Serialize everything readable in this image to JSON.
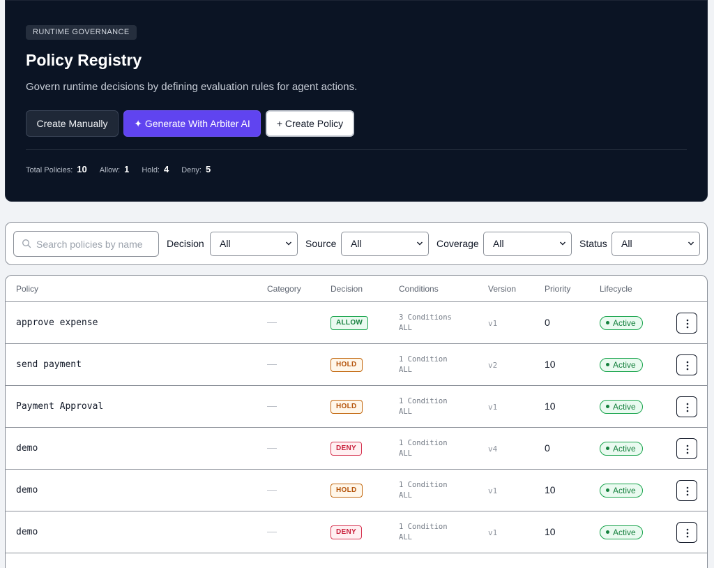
{
  "header": {
    "eyebrow": "RUNTIME GOVERNANCE",
    "title": "Policy Registry",
    "subtitle": "Govern runtime decisions by defining evaluation rules for agent actions.",
    "buttons": {
      "create_manually": "Create Manually",
      "generate_ai": "✦ Generate With Arbiter AI",
      "create_policy": "+ Create Policy"
    },
    "stats": [
      {
        "label": "Total Policies:",
        "value": "10"
      },
      {
        "label": "Allow:",
        "value": "1"
      },
      {
        "label": "Hold:",
        "value": "4"
      },
      {
        "label": "Deny:",
        "value": "5"
      }
    ]
  },
  "filters": {
    "search_placeholder": "Search policies by name",
    "decision": {
      "label": "Decision",
      "value": "All"
    },
    "source": {
      "label": "Source",
      "value": "All"
    },
    "coverage": {
      "label": "Coverage",
      "value": "All"
    },
    "status": {
      "label": "Status",
      "value": "All"
    }
  },
  "table": {
    "columns": [
      "Policy",
      "Category",
      "Decision",
      "Conditions",
      "Version",
      "Priority",
      "Lifecycle"
    ],
    "rows": [
      {
        "policy": "approve expense",
        "category": "—",
        "decision": "ALLOW",
        "conditions": "3 Conditions",
        "match": "ALL",
        "version": "v1",
        "priority": "0",
        "lifecycle": "Active"
      },
      {
        "policy": "send payment",
        "category": "—",
        "decision": "HOLD",
        "conditions": "1 Condition",
        "match": "ALL",
        "version": "v2",
        "priority": "10",
        "lifecycle": "Active"
      },
      {
        "policy": "Payment Approval",
        "category": "—",
        "decision": "HOLD",
        "conditions": "1 Condition",
        "match": "ALL",
        "version": "v1",
        "priority": "10",
        "lifecycle": "Active"
      },
      {
        "policy": "demo",
        "category": "—",
        "decision": "DENY",
        "conditions": "1 Condition",
        "match": "ALL",
        "version": "v4",
        "priority": "0",
        "lifecycle": "Active"
      },
      {
        "policy": "demo",
        "category": "—",
        "decision": "HOLD",
        "conditions": "1 Condition",
        "match": "ALL",
        "version": "v1",
        "priority": "10",
        "lifecycle": "Active"
      },
      {
        "policy": "demo",
        "category": "—",
        "decision": "DENY",
        "conditions": "1 Condition",
        "match": "ALL",
        "version": "v1",
        "priority": "10",
        "lifecycle": "Active"
      }
    ]
  },
  "colors": {
    "hero_bg": "#0b1424",
    "ai_button": "#6044f0",
    "allow": "#15803d",
    "hold": "#b45309",
    "deny": "#c81e3a"
  }
}
